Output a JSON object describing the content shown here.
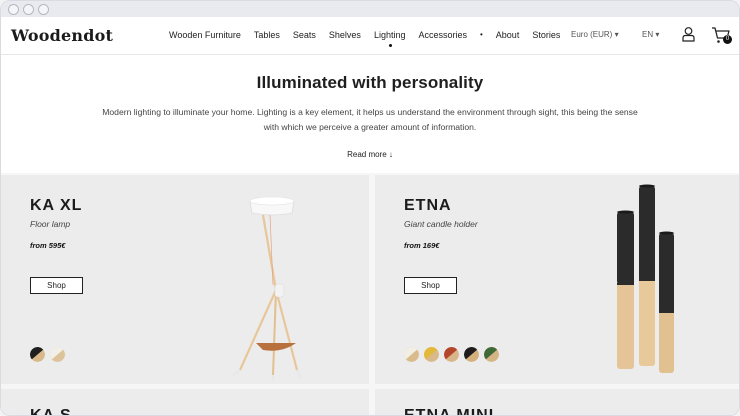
{
  "brand": {
    "logo": "Woodendot"
  },
  "nav": {
    "items": [
      "Wooden Furniture",
      "Tables",
      "Seats",
      "Shelves",
      "Lighting",
      "Accessories",
      "•",
      "About",
      "Stories"
    ],
    "active": "Lighting",
    "currency": "Euro (EUR) ▾",
    "language": "EN ▾",
    "cart_count": "0"
  },
  "intro": {
    "title": "Illuminated with personality",
    "text": "Modern lighting to illuminate your home. Lighting is a key element, it helps us understand the environment through sight, this being the sense with which we perceive a greater amount of information.",
    "read_more": "Read more ↓"
  },
  "products": [
    {
      "name": "KA XL",
      "subtitle": "Floor lamp",
      "price": "from 595€",
      "shop_label": "Shop",
      "swatches": [
        [
          "#1f1f1f",
          "#d9b98a"
        ],
        [
          "#f2efe8",
          "#dcc39a"
        ]
      ]
    },
    {
      "name": "ETNA",
      "subtitle": "Giant candle holder",
      "price": "from 169€",
      "shop_label": "Shop",
      "swatches": [
        [
          "#f3eee4",
          "#d9bb8c"
        ],
        [
          "#e2b93b",
          "#d6ab2f"
        ],
        [
          "#b4462c",
          "#d9b68a"
        ],
        [
          "#1d1d1d",
          "#d4b07c"
        ],
        [
          "#3f6a37",
          "#d6b584"
        ]
      ]
    },
    {
      "name": "KA S"
    },
    {
      "name": "ETNA MINI"
    }
  ],
  "colors": {
    "accent": "#111111",
    "card_bg": "#ececec",
    "wood": "#e2bf8e"
  }
}
